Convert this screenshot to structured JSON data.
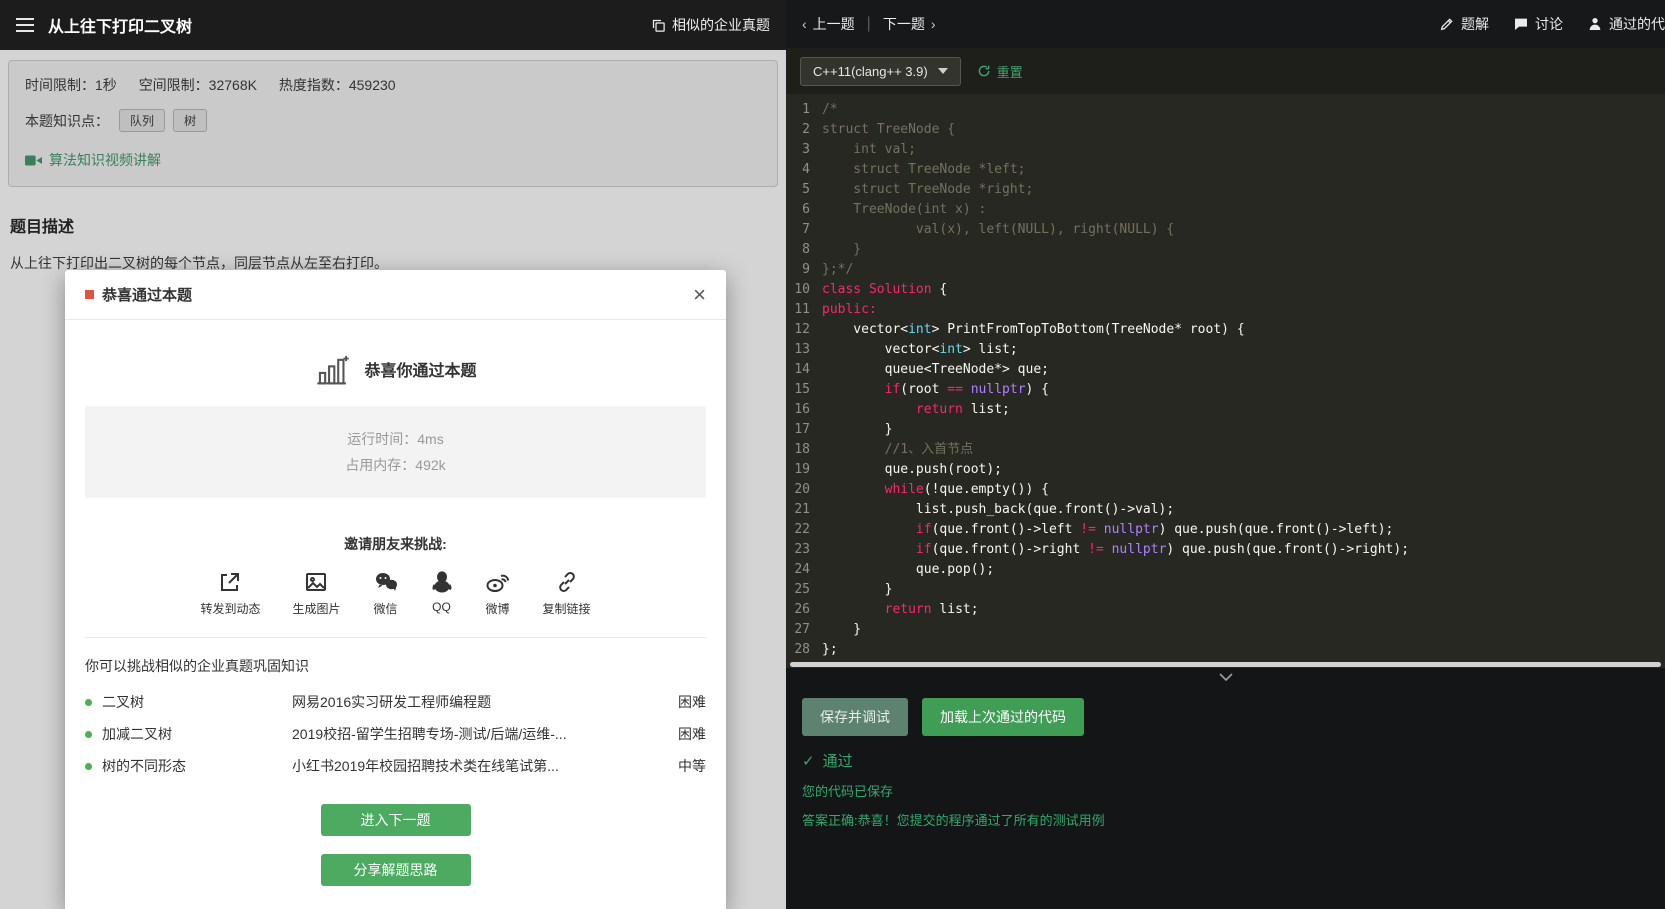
{
  "left": {
    "header": {
      "title": "从上往下打印二叉树",
      "similar_link": "相似的企业真题"
    },
    "info": {
      "time_limit": "时间限制：1秒",
      "space_limit": "空间限制：32768K",
      "heat_index": "热度指数：459230",
      "knowledge_label": "本题知识点：",
      "tags": [
        "队列",
        "树"
      ],
      "video_link": "算法知识视频讲解"
    },
    "section_title": "题目描述",
    "description": "从上往下打印出二叉树的每个节点，同层节点从左至右打印。"
  },
  "modal": {
    "title": "恭喜通过本题",
    "congrats": "恭喜你通过本题",
    "stats": {
      "runtime": "运行时间：4ms",
      "memory": "占用内存：492k"
    },
    "invite_label": "邀请朋友来挑战:",
    "share_items": [
      {
        "label": "转发到动态"
      },
      {
        "label": "生成图片"
      },
      {
        "label": "微信"
      },
      {
        "label": "QQ"
      },
      {
        "label": "微博"
      },
      {
        "label": "复制链接"
      }
    ],
    "hint": "你可以挑战相似的企业真题巩固知识",
    "problems": [
      {
        "name": "二叉树",
        "source": "网易2016实习研发工程师编程题",
        "difficulty": "困难"
      },
      {
        "name": "加减二叉树",
        "source": "2019校招-留学生招聘专场-测试/后端/运维-...",
        "difficulty": "困难"
      },
      {
        "name": "树的不同形态",
        "source": "小红书2019年校园招聘技术类在线笔试第...",
        "difficulty": "中等"
      }
    ],
    "next_button": "进入下一题",
    "share_button": "分享解题思路"
  },
  "right": {
    "nav": {
      "prev": "上一题",
      "next": "下一题",
      "actions": [
        {
          "label": "题解"
        },
        {
          "label": "讨论"
        },
        {
          "label": "通过的代码"
        }
      ]
    },
    "toolbar": {
      "language": "C++11(clang++ 3.9)",
      "reset": "重置"
    },
    "editor": {
      "lines": [
        [
          [
            "cm",
            "/*"
          ]
        ],
        [
          [
            "cm",
            "struct TreeNode {"
          ]
        ],
        [
          [
            "cm",
            "    int val;"
          ]
        ],
        [
          [
            "cm",
            "    struct TreeNode *left;"
          ]
        ],
        [
          [
            "cm",
            "    struct TreeNode *right;"
          ]
        ],
        [
          [
            "cm",
            "    TreeNode(int x) :"
          ]
        ],
        [
          [
            "cm",
            "            val(x), left(NULL), right(NULL) {"
          ]
        ],
        [
          [
            "cm",
            "    }"
          ]
        ],
        [
          [
            "cm",
            "};*/"
          ]
        ],
        [
          [
            "kw",
            "class Solution"
          ],
          [
            "pl",
            " {"
          ]
        ],
        [
          [
            "kw",
            "public:"
          ]
        ],
        [
          [
            "pl",
            "    vector<"
          ],
          [
            "ty",
            "int"
          ],
          [
            "pl",
            "> PrintFromTopToBottom(TreeNode* root) {"
          ]
        ],
        [
          [
            "pl",
            "        vector<"
          ],
          [
            "ty",
            "int"
          ],
          [
            "pl",
            "> list;"
          ]
        ],
        [
          [
            "pl",
            "        queue<TreeNode*> que;"
          ]
        ],
        [
          [
            "pl",
            "        "
          ],
          [
            "kw",
            "if"
          ],
          [
            "pl",
            "(root "
          ],
          [
            "kw",
            "=="
          ],
          [
            "pl",
            " "
          ],
          [
            "ct",
            "nullptr"
          ],
          [
            "pl",
            ") {"
          ]
        ],
        [
          [
            "pl",
            "            "
          ],
          [
            "kw",
            "return"
          ],
          [
            "pl",
            " list;"
          ]
        ],
        [
          [
            "pl",
            "        }"
          ]
        ],
        [
          [
            "cm",
            "        //1、入首节点"
          ]
        ],
        [
          [
            "pl",
            "        que.push(root);"
          ]
        ],
        [
          [
            "pl",
            "        "
          ],
          [
            "kw",
            "while"
          ],
          [
            "pl",
            "(!que.empty()) {"
          ]
        ],
        [
          [
            "pl",
            "            list.push_back(que.front()->val);"
          ]
        ],
        [
          [
            "pl",
            "            "
          ],
          [
            "kw",
            "if"
          ],
          [
            "pl",
            "(que.front()->left "
          ],
          [
            "kw",
            "!="
          ],
          [
            "pl",
            " "
          ],
          [
            "ct",
            "nullptr"
          ],
          [
            "pl",
            ") que.push(que.front()->left);"
          ]
        ],
        [
          [
            "pl",
            "            "
          ],
          [
            "kw",
            "if"
          ],
          [
            "pl",
            "(que.front()->right "
          ],
          [
            "kw",
            "!="
          ],
          [
            "pl",
            " "
          ],
          [
            "ct",
            "nullptr"
          ],
          [
            "pl",
            ") que.push(que.front()->right);"
          ]
        ],
        [
          [
            "pl",
            "            que.pop();"
          ]
        ],
        [
          [
            "pl",
            "        }"
          ]
        ],
        [
          [
            "pl",
            "        "
          ],
          [
            "kw",
            "return"
          ],
          [
            "pl",
            " list;"
          ]
        ],
        [
          [
            "pl",
            "    }"
          ]
        ],
        [
          [
            "pl",
            "};"
          ]
        ]
      ]
    },
    "footer": {
      "save_button": "保存并调试",
      "load_button": "加载上次通过的代码",
      "status": "通过",
      "saved_msg": "您的代码已保存",
      "result_msg": "答案正确:恭喜！您提交的程序通过了所有的测试用例"
    }
  },
  "colors": {
    "accent_green": "#4daa61",
    "success_green": "#35a86d",
    "editor_background": "#272822",
    "keyword_pink": "#f92672",
    "comment_gray": "#75715e",
    "type_cyan": "#66d9ef",
    "constant_purple": "#ae81ff"
  }
}
